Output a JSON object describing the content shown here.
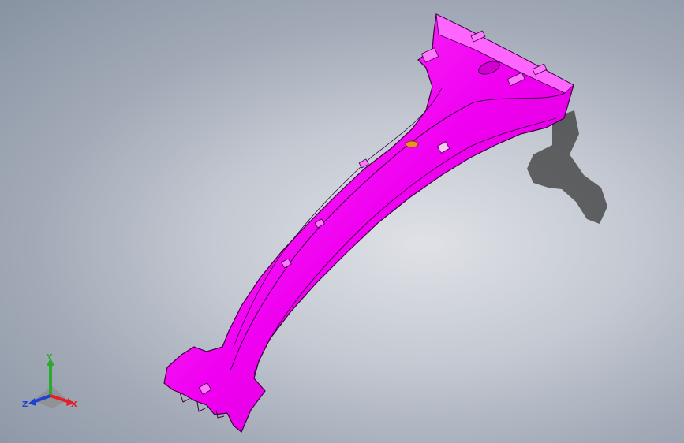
{
  "viewport": {
    "part_color": "#ff00ff",
    "part_edge_color": "#3a0040",
    "shadow_color": "#3a3a3a",
    "background_colors": [
      "#dfe1e6",
      "#8793a2"
    ]
  },
  "triad": {
    "x_label": "X",
    "y_label": "Y",
    "z_label": "Z",
    "x_color": "#e0202a",
    "y_color": "#2caa2c",
    "z_color": "#2040d0"
  }
}
